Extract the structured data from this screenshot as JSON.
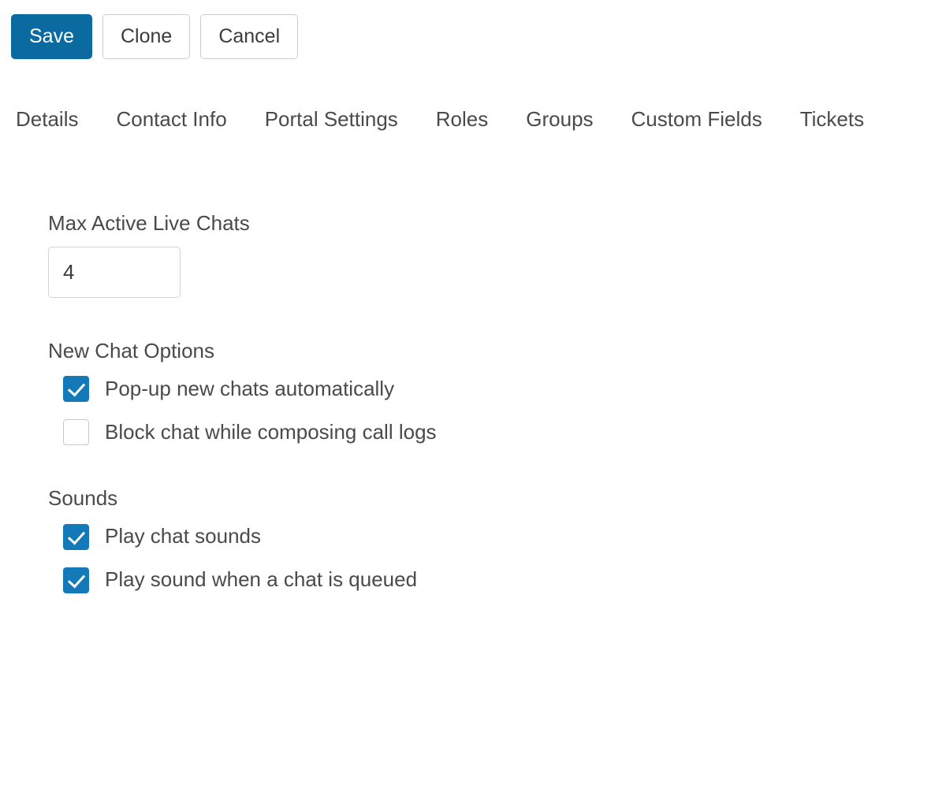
{
  "toolbar": {
    "buttons": [
      {
        "label": "Save",
        "style": "primary",
        "name": "save-button"
      },
      {
        "label": "Clone",
        "style": "secondary",
        "name": "clone-button"
      },
      {
        "label": "Cancel",
        "style": "secondary",
        "name": "cancel-button"
      }
    ],
    "primary_color": "#0b6ba0",
    "secondary_border_color": "#cdcdcd"
  },
  "tabs": [
    {
      "label": "Details"
    },
    {
      "label": "Contact Info"
    },
    {
      "label": "Portal Settings"
    },
    {
      "label": "Roles"
    },
    {
      "label": "Groups"
    },
    {
      "label": "Custom Fields"
    },
    {
      "label": "Tickets"
    }
  ],
  "form": {
    "max_active_live_chats": {
      "label": "Max Active Live Chats",
      "value": "4",
      "placeholder": ""
    },
    "new_chat_options": {
      "title": "New Chat Options",
      "options": [
        {
          "label": "Pop-up new chats automatically",
          "checked": true
        },
        {
          "label": "Block chat while composing call logs",
          "checked": false
        }
      ]
    },
    "sounds": {
      "title": "Sounds",
      "options": [
        {
          "label": "Play chat sounds",
          "checked": true
        },
        {
          "label": "Play sound when a chat is queued",
          "checked": true
        }
      ]
    }
  },
  "colors": {
    "checkbox_checked": "#1379b8",
    "text": "#4a4a4a",
    "background": "#ffffff"
  }
}
